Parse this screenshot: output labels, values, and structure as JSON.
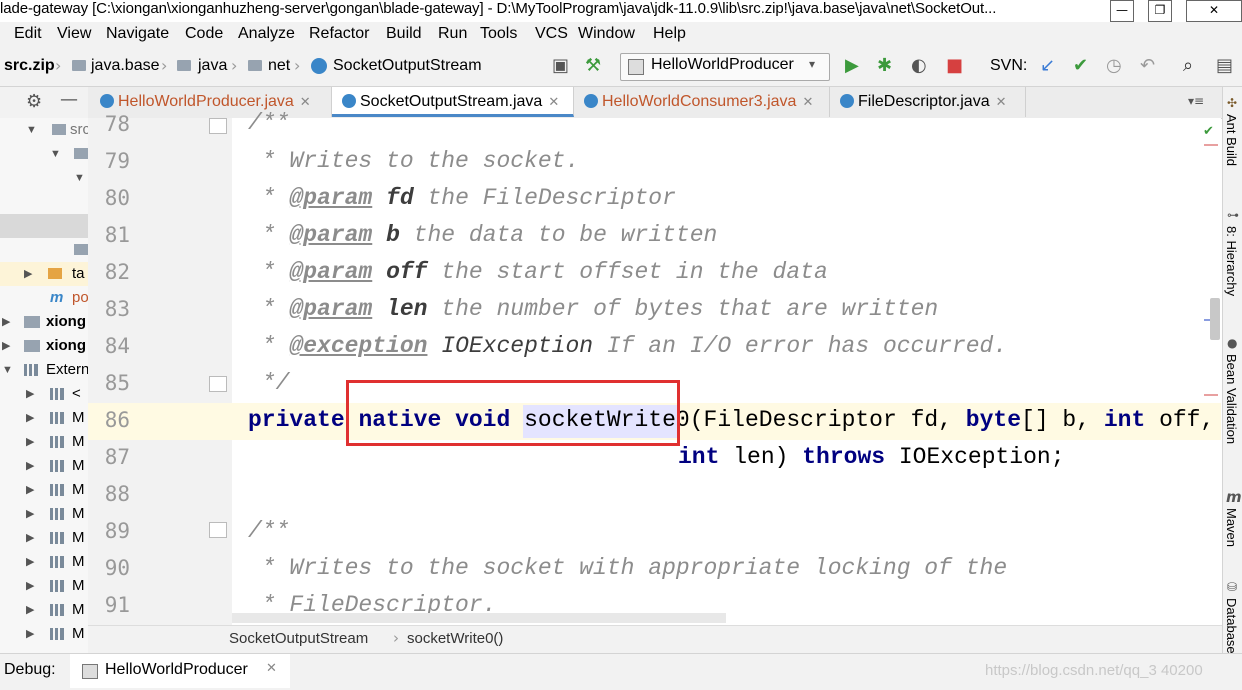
{
  "window": {
    "title": "lade-gateway [C:\\xiongan\\xionganhuzheng-server\\gongan\\blade-gateway] - D:\\MyToolProgram\\java\\jdk-11.0.9\\lib\\src.zip!\\java.base\\java\\net\\SocketOut..."
  },
  "menu": [
    "Edit",
    "View",
    "Navigate",
    "Code",
    "Analyze",
    "Refactor",
    "Build",
    "Run",
    "Tools",
    "VCS",
    "Window",
    "Help"
  ],
  "breadcrumbs": [
    "src.zip",
    "java.base",
    "java",
    "net",
    "SocketOutputStream"
  ],
  "run_config": "HelloWorldProducer",
  "svn_label": "SVN:",
  "tabs": [
    {
      "label": "HelloWorldProducer.java"
    },
    {
      "label": "SocketOutputStream.java"
    },
    {
      "label": "HelloWorldConsumer3.java"
    },
    {
      "label": "FileDescriptor.java"
    }
  ],
  "project_tree": {
    "items": [
      "src",
      "ta",
      "po",
      "xiong",
      "xiong",
      "Extern",
      "<",
      "M",
      "M",
      "M",
      "M",
      "M",
      "M",
      "M",
      "M",
      "M",
      "M"
    ]
  },
  "editor": {
    "line_numbers": [
      "78",
      "79",
      "80",
      "81",
      "82",
      "83",
      "84",
      "85",
      "86",
      "87",
      "88",
      "89",
      "90",
      "91"
    ],
    "l78": "/**",
    "l79": " * Writes to the socket.",
    "l80_pre": " * ",
    "l80_tag": "@param",
    "l80_name": "fd",
    "l80_text": " the FileDescriptor",
    "l81_tag": "@param",
    "l81_name": "b",
    "l81_text": " the data to be written",
    "l82_tag": "@param",
    "l82_name": "off",
    "l82_text": " the start offset in the data",
    "l83_tag": "@param",
    "l83_name": "len",
    "l83_text": " the number of bytes that are written",
    "l84_tag": "@exception",
    "l84_name": "IOException",
    "l84_text": " If an I/O error has occurred.",
    "l85": " */",
    "l86_private": "private",
    "l86_native": "native",
    "l86_void": "void",
    "l86_method": "socketWrite0",
    "l86_p1": "(FileDescriptor fd, ",
    "l86_byte": "byte",
    "l86_p2": "[] b, ",
    "l86_int": "int",
    "l86_p3": " off,",
    "l87_int": "int",
    "l87_len": " len) ",
    "l87_throws": "throws",
    "l87_exc": " IOException;",
    "l89": "/**",
    "l90": " * Writes to the socket with appropriate locking of the",
    "l91": " * FileDescriptor."
  },
  "editor_breadcrumb": [
    "SocketOutputStream",
    "socketWrite0()"
  ],
  "right_tools": [
    "Ant Build",
    "8: Hierarchy",
    "Bean Validation",
    "Maven",
    "Database"
  ],
  "debug": {
    "label": "Debug:",
    "config": "HelloWorldProducer"
  },
  "watermark": "https://blog.csdn.net/qq_3    40200"
}
